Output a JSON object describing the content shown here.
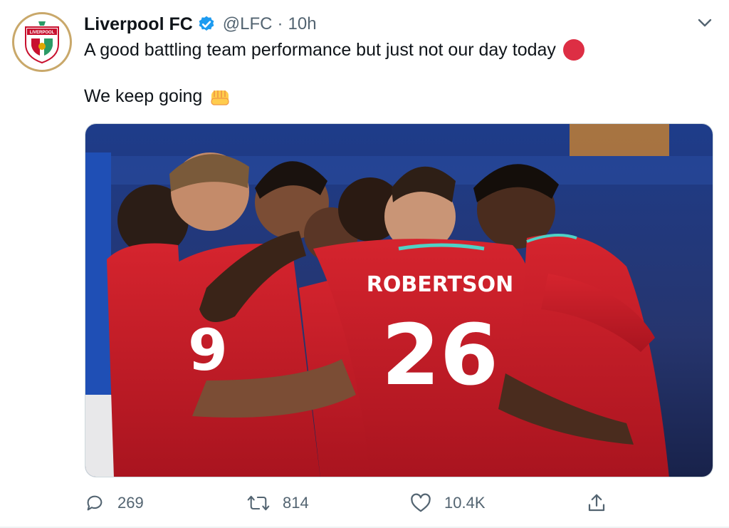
{
  "tweet": {
    "author_name": "Liverpool FC",
    "handle": "@LFC",
    "separator": "·",
    "time": "10h",
    "text_line1": "A good battling team performance but just not our day today",
    "text_line2": "We keep going"
  },
  "avatar": {
    "crest_text": "LIVERPOOL"
  },
  "media": {
    "jersey_name": "ROBERTSON",
    "jersey_number": "26",
    "jersey_number_left": "9"
  },
  "actions": {
    "reply_count": "269",
    "retweet_count": "814",
    "like_count": "10.4K"
  },
  "icons": {
    "verified": "verified-badge-icon",
    "menu": "chevron-down-icon",
    "reply": "reply-icon",
    "retweet": "retweet-icon",
    "like": "heart-icon",
    "share": "share-icon"
  },
  "colors": {
    "verified_blue": "#1d9bf0",
    "emoji_red": "#dd2e44",
    "kit_red": "#c8102e",
    "crest_gold": "#c9a86a",
    "muted": "#536471"
  }
}
